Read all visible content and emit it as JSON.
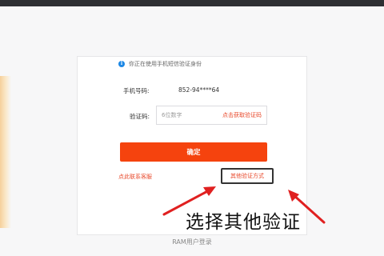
{
  "notice": {
    "icon": "info-icon",
    "text": "你正在使用手机短信验证身份"
  },
  "phone": {
    "label": "手机号码:",
    "value": "852-94****64"
  },
  "code": {
    "label": "验证码:",
    "placeholder": "6位数字",
    "get_code": "点击获取验证码"
  },
  "confirm_label": "确定",
  "contact_label": "点此联系客服",
  "other_method_label": "其他验证方式",
  "annotation": {
    "text": "选择其他验证",
    "color": "#e02020"
  },
  "footer": "RAM用户登录",
  "colors": {
    "accent": "#f5430e",
    "link": "#e8492b",
    "info": "#1e88e5"
  }
}
